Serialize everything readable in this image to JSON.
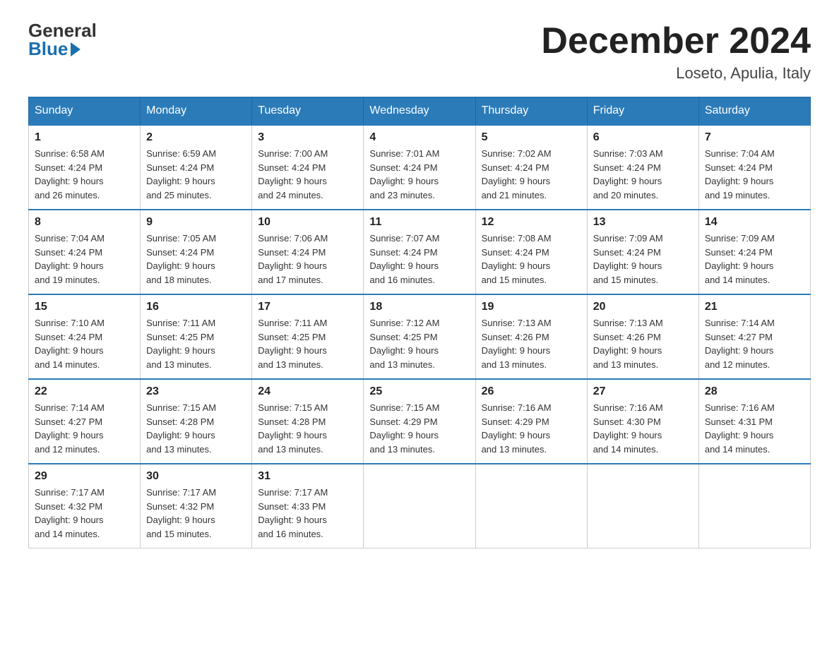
{
  "header": {
    "logo_general": "General",
    "logo_blue": "Blue",
    "month_year": "December 2024",
    "location": "Loseto, Apulia, Italy"
  },
  "days_of_week": [
    "Sunday",
    "Monday",
    "Tuesday",
    "Wednesday",
    "Thursday",
    "Friday",
    "Saturday"
  ],
  "weeks": [
    [
      {
        "day": "1",
        "info": "Sunrise: 6:58 AM\nSunset: 4:24 PM\nDaylight: 9 hours\nand 26 minutes."
      },
      {
        "day": "2",
        "info": "Sunrise: 6:59 AM\nSunset: 4:24 PM\nDaylight: 9 hours\nand 25 minutes."
      },
      {
        "day": "3",
        "info": "Sunrise: 7:00 AM\nSunset: 4:24 PM\nDaylight: 9 hours\nand 24 minutes."
      },
      {
        "day": "4",
        "info": "Sunrise: 7:01 AM\nSunset: 4:24 PM\nDaylight: 9 hours\nand 23 minutes."
      },
      {
        "day": "5",
        "info": "Sunrise: 7:02 AM\nSunset: 4:24 PM\nDaylight: 9 hours\nand 21 minutes."
      },
      {
        "day": "6",
        "info": "Sunrise: 7:03 AM\nSunset: 4:24 PM\nDaylight: 9 hours\nand 20 minutes."
      },
      {
        "day": "7",
        "info": "Sunrise: 7:04 AM\nSunset: 4:24 PM\nDaylight: 9 hours\nand 19 minutes."
      }
    ],
    [
      {
        "day": "8",
        "info": "Sunrise: 7:04 AM\nSunset: 4:24 PM\nDaylight: 9 hours\nand 19 minutes."
      },
      {
        "day": "9",
        "info": "Sunrise: 7:05 AM\nSunset: 4:24 PM\nDaylight: 9 hours\nand 18 minutes."
      },
      {
        "day": "10",
        "info": "Sunrise: 7:06 AM\nSunset: 4:24 PM\nDaylight: 9 hours\nand 17 minutes."
      },
      {
        "day": "11",
        "info": "Sunrise: 7:07 AM\nSunset: 4:24 PM\nDaylight: 9 hours\nand 16 minutes."
      },
      {
        "day": "12",
        "info": "Sunrise: 7:08 AM\nSunset: 4:24 PM\nDaylight: 9 hours\nand 15 minutes."
      },
      {
        "day": "13",
        "info": "Sunrise: 7:09 AM\nSunset: 4:24 PM\nDaylight: 9 hours\nand 15 minutes."
      },
      {
        "day": "14",
        "info": "Sunrise: 7:09 AM\nSunset: 4:24 PM\nDaylight: 9 hours\nand 14 minutes."
      }
    ],
    [
      {
        "day": "15",
        "info": "Sunrise: 7:10 AM\nSunset: 4:24 PM\nDaylight: 9 hours\nand 14 minutes."
      },
      {
        "day": "16",
        "info": "Sunrise: 7:11 AM\nSunset: 4:25 PM\nDaylight: 9 hours\nand 13 minutes."
      },
      {
        "day": "17",
        "info": "Sunrise: 7:11 AM\nSunset: 4:25 PM\nDaylight: 9 hours\nand 13 minutes."
      },
      {
        "day": "18",
        "info": "Sunrise: 7:12 AM\nSunset: 4:25 PM\nDaylight: 9 hours\nand 13 minutes."
      },
      {
        "day": "19",
        "info": "Sunrise: 7:13 AM\nSunset: 4:26 PM\nDaylight: 9 hours\nand 13 minutes."
      },
      {
        "day": "20",
        "info": "Sunrise: 7:13 AM\nSunset: 4:26 PM\nDaylight: 9 hours\nand 13 minutes."
      },
      {
        "day": "21",
        "info": "Sunrise: 7:14 AM\nSunset: 4:27 PM\nDaylight: 9 hours\nand 12 minutes."
      }
    ],
    [
      {
        "day": "22",
        "info": "Sunrise: 7:14 AM\nSunset: 4:27 PM\nDaylight: 9 hours\nand 12 minutes."
      },
      {
        "day": "23",
        "info": "Sunrise: 7:15 AM\nSunset: 4:28 PM\nDaylight: 9 hours\nand 13 minutes."
      },
      {
        "day": "24",
        "info": "Sunrise: 7:15 AM\nSunset: 4:28 PM\nDaylight: 9 hours\nand 13 minutes."
      },
      {
        "day": "25",
        "info": "Sunrise: 7:15 AM\nSunset: 4:29 PM\nDaylight: 9 hours\nand 13 minutes."
      },
      {
        "day": "26",
        "info": "Sunrise: 7:16 AM\nSunset: 4:29 PM\nDaylight: 9 hours\nand 13 minutes."
      },
      {
        "day": "27",
        "info": "Sunrise: 7:16 AM\nSunset: 4:30 PM\nDaylight: 9 hours\nand 14 minutes."
      },
      {
        "day": "28",
        "info": "Sunrise: 7:16 AM\nSunset: 4:31 PM\nDaylight: 9 hours\nand 14 minutes."
      }
    ],
    [
      {
        "day": "29",
        "info": "Sunrise: 7:17 AM\nSunset: 4:32 PM\nDaylight: 9 hours\nand 14 minutes."
      },
      {
        "day": "30",
        "info": "Sunrise: 7:17 AM\nSunset: 4:32 PM\nDaylight: 9 hours\nand 15 minutes."
      },
      {
        "day": "31",
        "info": "Sunrise: 7:17 AM\nSunset: 4:33 PM\nDaylight: 9 hours\nand 16 minutes."
      },
      null,
      null,
      null,
      null
    ]
  ]
}
